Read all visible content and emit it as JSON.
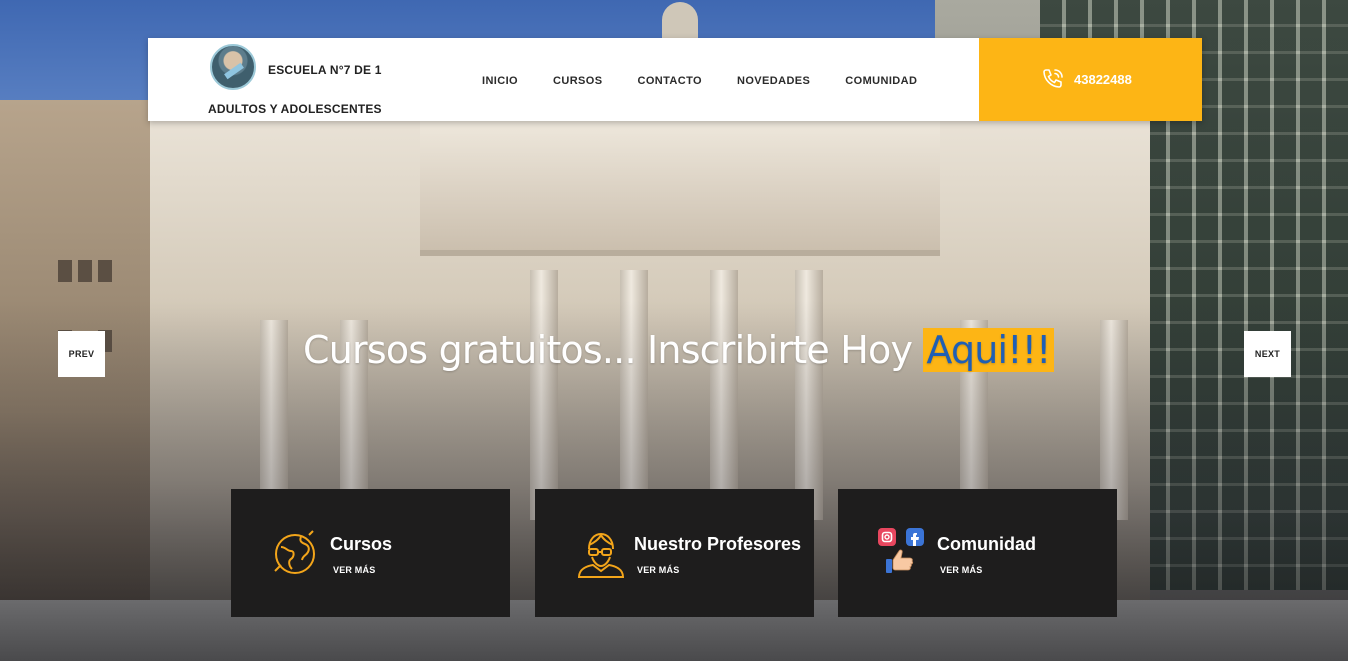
{
  "header": {
    "school_name": "ESCUELA N°7 DE 1",
    "school_sub": "ADULTOS Y ADOLESCENTES",
    "phone": "43822488",
    "nav": [
      {
        "label": "INICIO"
      },
      {
        "label": "CURSOS"
      },
      {
        "label": "CONTACTO"
      },
      {
        "label": "NOVEDADES"
      },
      {
        "label": "COMUNIDAD"
      }
    ]
  },
  "hero": {
    "text": "Cursos gratuitos... Inscribirte Hoy ",
    "highlight": "Aqui!!!",
    "prev_label": "PREV",
    "next_label": "NEXT"
  },
  "cards": [
    {
      "title": "Cursos",
      "more": "VER MÁS",
      "icon": "globe-icon"
    },
    {
      "title": "Nuestro Profesores",
      "more": "VER MÁS",
      "icon": "teacher-icon"
    },
    {
      "title": "Comunidad",
      "more": "VER MÁS",
      "icon": "social-icon"
    }
  ],
  "colors": {
    "accent": "#fdb515",
    "card_bg": "#1e1d1d",
    "highlight_text": "#1f5fb5"
  }
}
